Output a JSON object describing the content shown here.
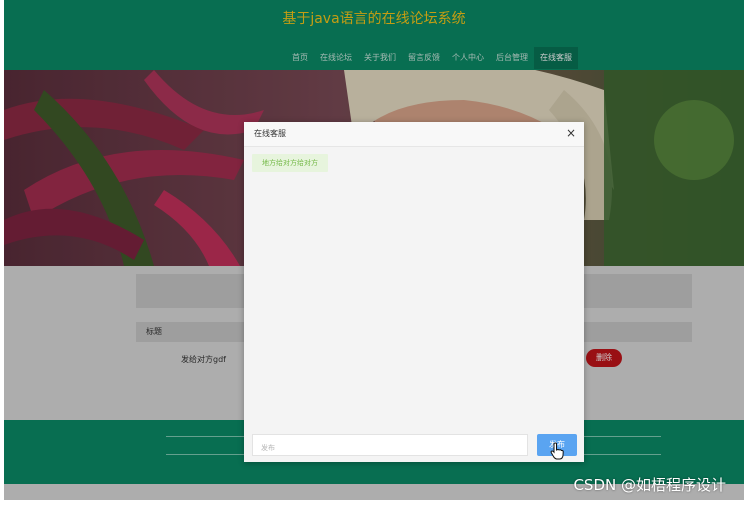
{
  "header": {
    "title": "基于java语言的在线论坛系统"
  },
  "nav": {
    "items": [
      {
        "label": "首页"
      },
      {
        "label": "在线论坛"
      },
      {
        "label": "关于我们"
      },
      {
        "label": "留言反馈"
      },
      {
        "label": "个人中心"
      },
      {
        "label": "后台管理"
      },
      {
        "label": "在线客服",
        "active": true
      }
    ]
  },
  "content": {
    "table_header": "标题",
    "row_title": "发给对方gdf",
    "delete_label": "删除"
  },
  "dialog": {
    "title": "在线客服",
    "messages": [
      {
        "text": "地方给对方给对方"
      }
    ],
    "input_placeholder": "发布",
    "send_label": "发布"
  },
  "watermark": "CSDN @如梧程序设计",
  "colors": {
    "header_bg": "#0a8a66",
    "title_color": "#f5c518",
    "delete_bg": "#c0141a",
    "send_bg": "#5aa4f1",
    "bubble_bg": "#e7f4dd",
    "bubble_text": "#74b947"
  }
}
